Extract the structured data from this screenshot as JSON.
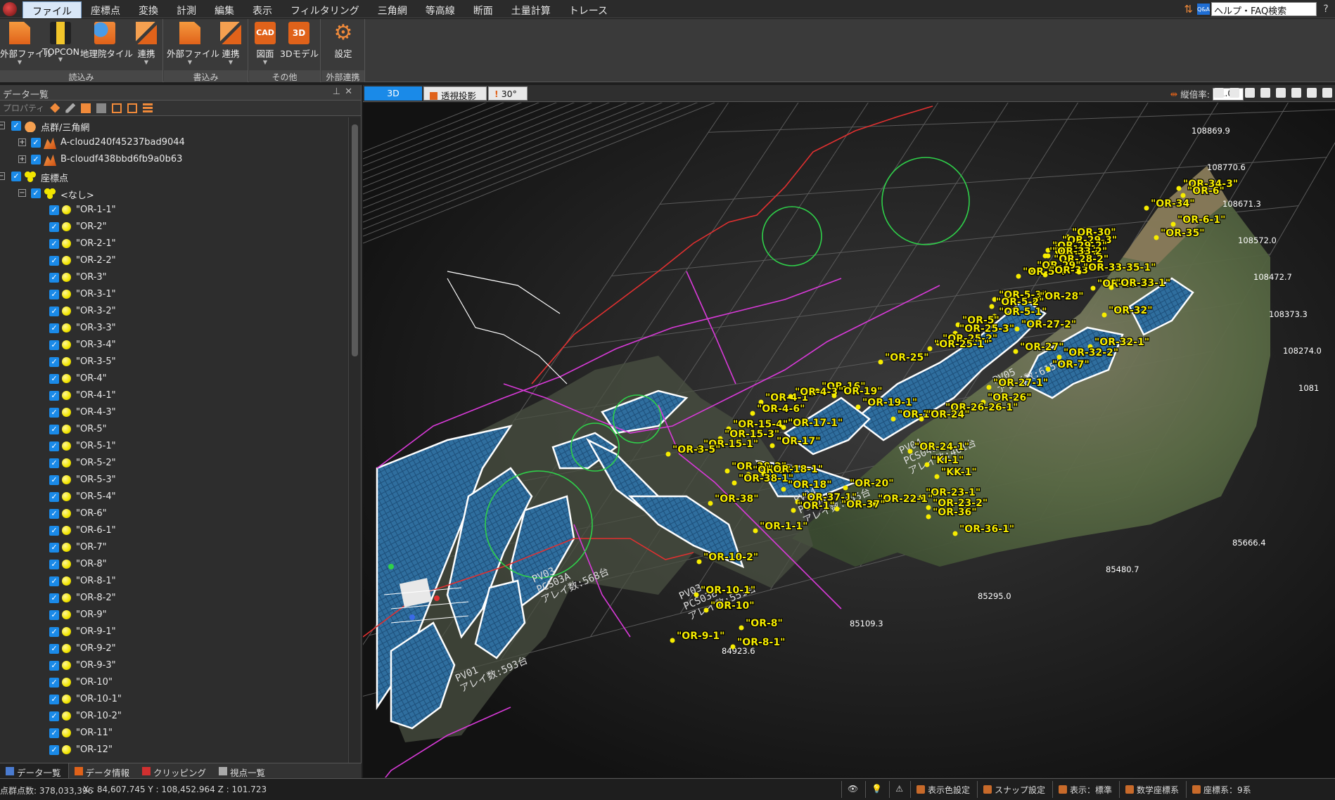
{
  "menu": {
    "tabs": [
      "ファイル",
      "座標点",
      "変換",
      "計測",
      "編集",
      "表示",
      "フィルタリング",
      "三角網",
      "等高線",
      "断面",
      "土量計算",
      "トレース"
    ],
    "active_tab": "ファイル",
    "help_text": "ヘルプ・FAQ検索",
    "help_qa_badge": "Q&A"
  },
  "ribbon": {
    "groups": [
      {
        "label": "読込み",
        "buttons": [
          "外部ファイル",
          "TOPCON",
          "地理院タイル",
          "連携"
        ]
      },
      {
        "label": "書込み",
        "buttons": [
          "外部ファイル",
          "連携"
        ]
      },
      {
        "label": "その他",
        "buttons": [
          "図面",
          "3Dモデル"
        ]
      },
      {
        "label": "外部連携",
        "buttons": [
          "設定"
        ]
      }
    ],
    "icon_text": {
      "cad": "CAD",
      "model3d": "3D"
    }
  },
  "left_panel": {
    "title": "データ一覧",
    "toolbar_property": "プロパティ",
    "tree": [
      {
        "level": 0,
        "label": "点群/三角網",
        "icon": "cloud-group-icon",
        "expander": "-"
      },
      {
        "level": 1,
        "label": "A-cloud240f45237bad9044",
        "icon": "point-cloud-icon",
        "expander": "+"
      },
      {
        "level": 1,
        "label": "B-cloudf438bbd6fb9a0b63",
        "icon": "point-cloud-icon",
        "expander": "+"
      },
      {
        "level": 0,
        "label": "座標点",
        "icon": "point-group-icon",
        "expander": "-"
      },
      {
        "level": 1,
        "label": "<なし>",
        "icon": "point-group-icon",
        "expander": "-"
      },
      {
        "level": 2,
        "label": "\"OR-1-1\"",
        "icon": "point-icon"
      },
      {
        "level": 2,
        "label": "\"OR-2\"",
        "icon": "point-icon"
      },
      {
        "level": 2,
        "label": "\"OR-2-1\"",
        "icon": "point-icon"
      },
      {
        "level": 2,
        "label": "\"OR-2-2\"",
        "icon": "point-icon"
      },
      {
        "level": 2,
        "label": "\"OR-3\"",
        "icon": "point-icon"
      },
      {
        "level": 2,
        "label": "\"OR-3-1\"",
        "icon": "point-icon"
      },
      {
        "level": 2,
        "label": "\"OR-3-2\"",
        "icon": "point-icon"
      },
      {
        "level": 2,
        "label": "\"OR-3-3\"",
        "icon": "point-icon"
      },
      {
        "level": 2,
        "label": "\"OR-3-4\"",
        "icon": "point-icon"
      },
      {
        "level": 2,
        "label": "\"OR-3-5\"",
        "icon": "point-icon"
      },
      {
        "level": 2,
        "label": "\"OR-4\"",
        "icon": "point-icon"
      },
      {
        "level": 2,
        "label": "\"OR-4-1\"",
        "icon": "point-icon"
      },
      {
        "level": 2,
        "label": "\"OR-4-3\"",
        "icon": "point-icon"
      },
      {
        "level": 2,
        "label": "\"OR-5\"",
        "icon": "point-icon"
      },
      {
        "level": 2,
        "label": "\"OR-5-1\"",
        "icon": "point-icon"
      },
      {
        "level": 2,
        "label": "\"OR-5-2\"",
        "icon": "point-icon"
      },
      {
        "level": 2,
        "label": "\"OR-5-3\"",
        "icon": "point-icon"
      },
      {
        "level": 2,
        "label": "\"OR-5-4\"",
        "icon": "point-icon"
      },
      {
        "level": 2,
        "label": "\"OR-6\"",
        "icon": "point-icon"
      },
      {
        "level": 2,
        "label": "\"OR-6-1\"",
        "icon": "point-icon"
      },
      {
        "level": 2,
        "label": "\"OR-7\"",
        "icon": "point-icon"
      },
      {
        "level": 2,
        "label": "\"OR-8\"",
        "icon": "point-icon"
      },
      {
        "level": 2,
        "label": "\"OR-8-1\"",
        "icon": "point-icon"
      },
      {
        "level": 2,
        "label": "\"OR-8-2\"",
        "icon": "point-icon"
      },
      {
        "level": 2,
        "label": "\"OR-9\"",
        "icon": "point-icon"
      },
      {
        "level": 2,
        "label": "\"OR-9-1\"",
        "icon": "point-icon"
      },
      {
        "level": 2,
        "label": "\"OR-9-2\"",
        "icon": "point-icon"
      },
      {
        "level": 2,
        "label": "\"OR-9-3\"",
        "icon": "point-icon"
      },
      {
        "level": 2,
        "label": "\"OR-10\"",
        "icon": "point-icon"
      },
      {
        "level": 2,
        "label": "\"OR-10-1\"",
        "icon": "point-icon"
      },
      {
        "level": 2,
        "label": "\"OR-10-2\"",
        "icon": "point-icon"
      },
      {
        "level": 2,
        "label": "\"OR-11\"",
        "icon": "point-icon"
      },
      {
        "level": 2,
        "label": "\"OR-12\"",
        "icon": "point-icon"
      }
    ],
    "bottom_tabs": [
      "データ一覧",
      "データ情報",
      "クリッピング",
      "視点一覧"
    ],
    "active_bottom_tab": "データ一覧"
  },
  "viewport": {
    "tabs": {
      "view_3d": "3D",
      "perspective": "透視投影",
      "angle": "30°"
    },
    "vertical_scale_label": "縦倍率:",
    "vertical_scale_value": "1.0",
    "axis_labels_y": [
      "108869.9",
      "108770.6",
      "108671.3",
      "108572.0",
      "108472.7",
      "108373.3",
      "108274.0",
      "1081"
    ],
    "axis_labels_x": [
      "85666.4",
      "85480.7",
      "85295.0",
      "85109.3",
      "84923.6"
    ],
    "pv_labels": [
      {
        "lines": [
          "PV05",
          "アレイ数:615台"
        ]
      },
      {
        "lines": [
          "PV04",
          "PCS04B",
          "アレイ数:461台"
        ]
      },
      {
        "lines": [
          "PV04",
          "PCS04A",
          "アレイ数:545台"
        ]
      },
      {
        "lines": [
          "PV03",
          "PCS03A",
          "アレイ数:568台"
        ]
      },
      {
        "lines": [
          "PV03",
          "PCS03B",
          "アレイ数:551台"
        ]
      },
      {
        "lines": [
          "PV01",
          "アレイ数:593台"
        ]
      }
    ],
    "point_labels": [
      "\"OR-34-3\"",
      "\"OR-6\"",
      "\"OR-34\"",
      "\"OR-6-1\"",
      "\"OR-35\"",
      "\"OR-30\"",
      "\"OR-29-3\"",
      "\"OR-29-2\"",
      "\"OR-29-1\"",
      "\"OR-33-2\"",
      "\"OR-28-2\"",
      "\"OR-29\"",
      "\"OR-5-4\"",
      "\"OR-33\"",
      "\"OR-33-35-1\"",
      "\"OR-28-1\"",
      "\"OR-33-1\"",
      "\"OR-5-3\"",
      "\"OR-28\"",
      "\"OR-5-2\"",
      "\"OR-5-1\"",
      "\"OR-32\"",
      "\"OR-5\"",
      "\"OR-27-2\"",
      "\"OR-25-3\"",
      "\"OR-25-2\"",
      "\"OR-25-1\"",
      "\"OR-32-1\"",
      "\"OR-27\"",
      "\"OR-32-2\"",
      "\"OR-7\"",
      "\"OR-25\"",
      "\"OR-27-1\"",
      "\"OR-16\"",
      "\"OR-4-1\"",
      "\"OR-4-3\"",
      "\"OR-19\"",
      "\"OR-26\"",
      "\"OR-19-1\"",
      "\"OR-4-6\"",
      "\"OR-26-26-1\"",
      "\"OR-1\"",
      "\"OR-24\"",
      "\"OR-15-4\"",
      "\"OR-17-1\"",
      "\"OR-15-3\"",
      "\"OR-15-1\"",
      "\"OR-17\"",
      "\"OR-3-5\"",
      "\"OR-24-1\"",
      "\"KI-1\"",
      "\"OR-38-2\"",
      "\"OR-14\"",
      "\"OR-18-1\"",
      "\"KK-1\"",
      "\"OR-38-1\"",
      "\"OR-18\"",
      "\"OR-20\"",
      "\"OR-23-1\"",
      "\"OR-38\"",
      "\"OR-37-1\"",
      "\"OR-22-1\"",
      "\"OR-23-2\"",
      "\"OR-1\"",
      "\"OR-37\"",
      "\"OR-36\"",
      "\"OR-1-1\"",
      "\"OR-36-1\"",
      "\"OR-10-2\"",
      "\"OR-10-1\"",
      "\"OR-10\"",
      "\"OR-8\"",
      "\"OR-9-1\"",
      "\"OR-8-1\""
    ]
  },
  "status": {
    "points": "点群点数: 378,033,396",
    "coords": "X : 84,607.745  Y : 108,452.964  Z : 101.723",
    "buttons": [
      "表示色設定",
      "スナップ設定",
      "表示：標準",
      "数学座標系",
      "座標系：9系"
    ]
  },
  "colors": {
    "accent": "#1a8ae8",
    "label_yellow": "#f6ec00",
    "boundary_red": "#e23030",
    "road_magenta": "#d83ad8",
    "circle_green": "#2fd04a"
  }
}
